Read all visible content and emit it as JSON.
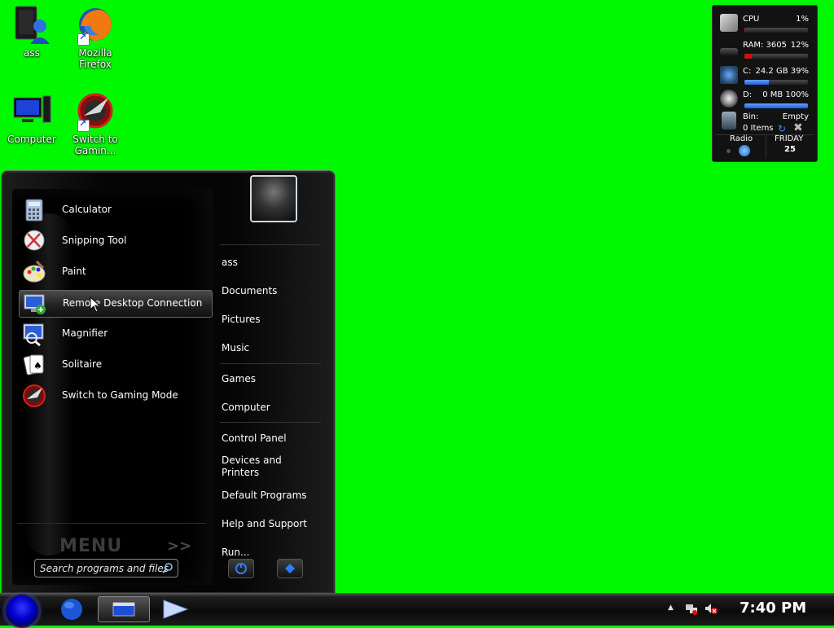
{
  "desktop": {
    "icons": [
      {
        "label": "ass"
      },
      {
        "label": "Mozilla\nFirefox"
      },
      {
        "label": "Computer"
      },
      {
        "label": "Switch to\nGamin..."
      }
    ]
  },
  "gadget": {
    "cpu": {
      "name": "CPU",
      "value": "1%",
      "fill": 0.01
    },
    "ram": {
      "name": "RAM: 3605",
      "value": "12%",
      "fill": 0.12
    },
    "c_drive": {
      "name": "C:",
      "value": "24.2 GB 39%",
      "fill": 0.39
    },
    "d_drive": {
      "name": "D:",
      "value": "0 MB 100%",
      "fill": 1.0
    },
    "bin": {
      "name": "Bin:",
      "status": "Empty",
      "items": "0 Items"
    },
    "radio": "Radio",
    "day": "FRIDAY",
    "date": "25"
  },
  "start_menu": {
    "programs": [
      {
        "label": "Calculator"
      },
      {
        "label": "Snipping Tool"
      },
      {
        "label": "Paint"
      },
      {
        "label": "Remote Desktop Connection",
        "highlighted": true
      },
      {
        "label": "Magnifier"
      },
      {
        "label": "Solitaire"
      },
      {
        "label": "Switch to Gaming Mode"
      }
    ],
    "logo_text": "MENU",
    "more_arrows": ">>",
    "search_placeholder": "Search programs and files",
    "right_links": {
      "user": "ass",
      "documents": "Documents",
      "pictures": "Pictures",
      "music": "Music",
      "games": "Games",
      "computer": "Computer",
      "control_panel": "Control Panel",
      "devices_line1": "Devices and",
      "devices_line2": "Printers",
      "default_programs": "Default Programs",
      "help": "Help and Support",
      "run": "Run..."
    }
  },
  "taskbar": {
    "clock": "7:40 PM"
  },
  "colors": {
    "desktop_bg": "#00f800",
    "accent_blue": "#1e6cff",
    "bar_red": "#d01010"
  }
}
